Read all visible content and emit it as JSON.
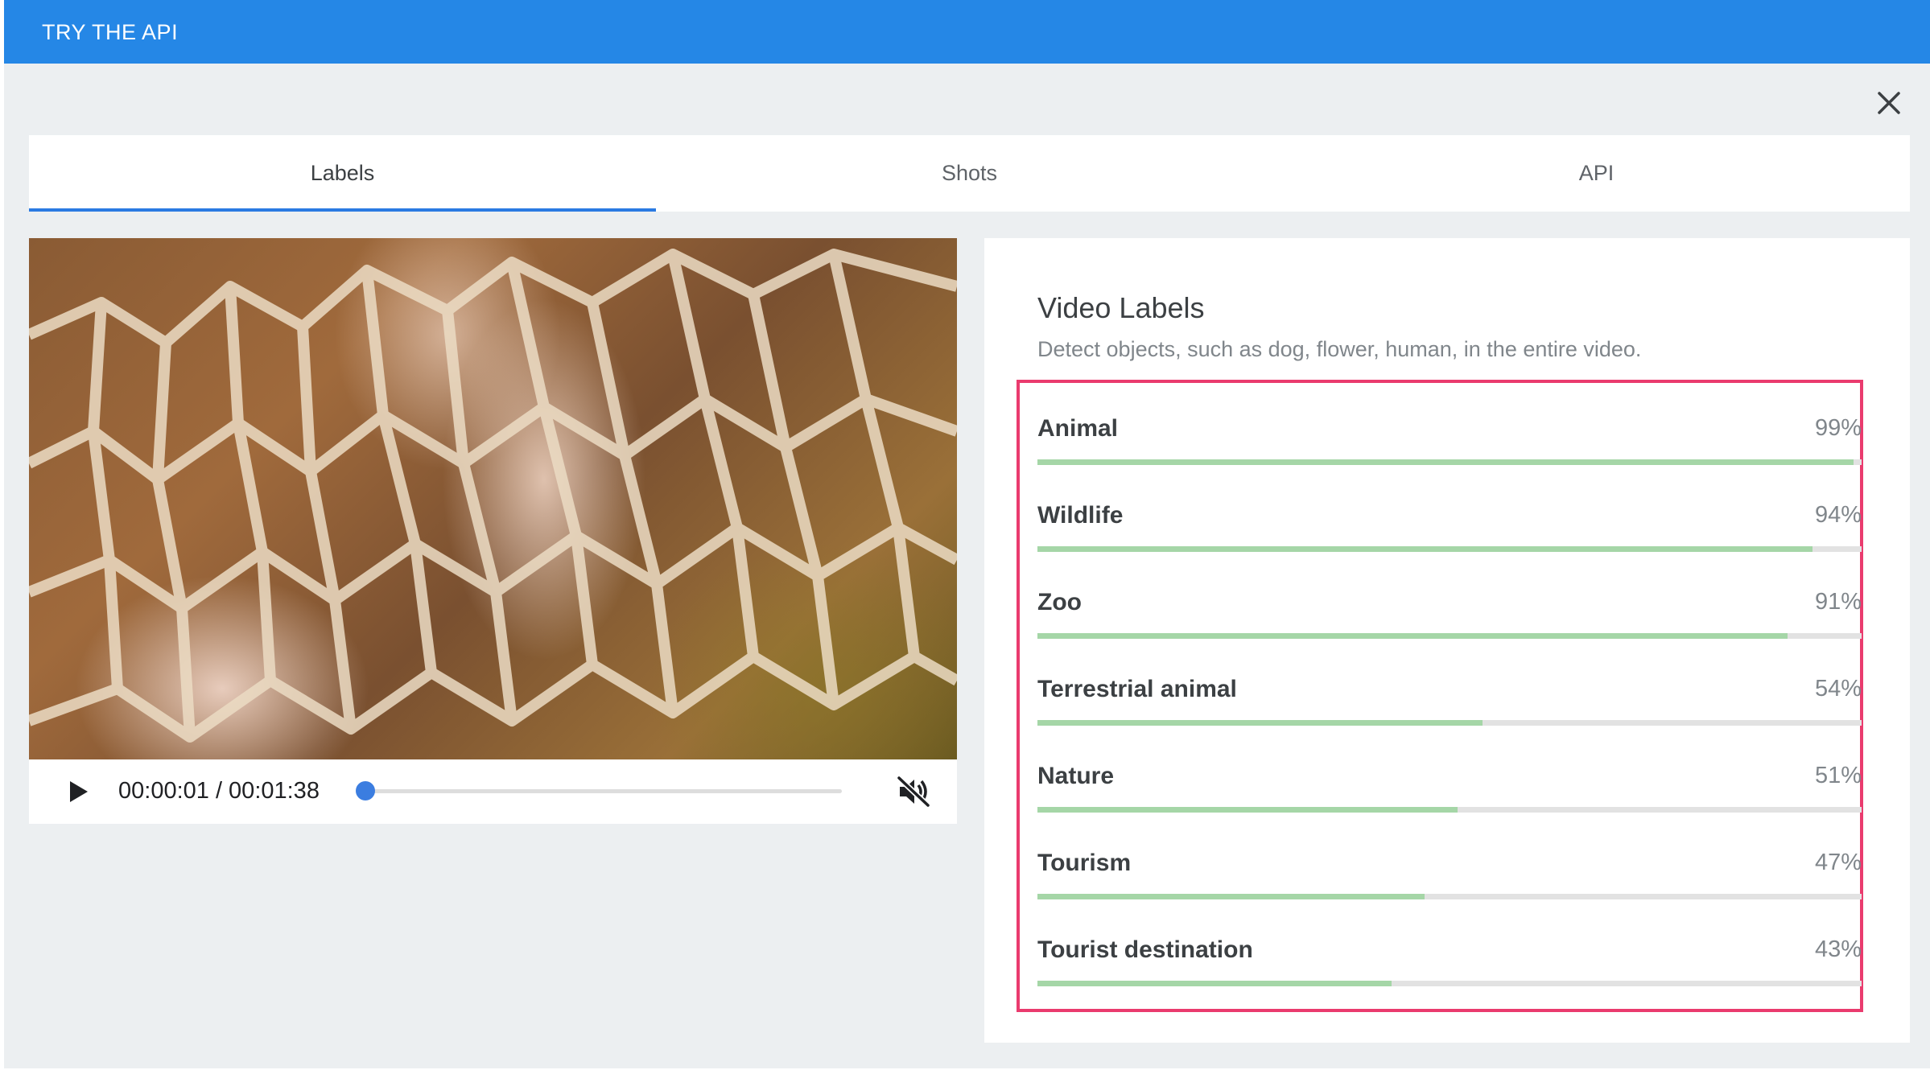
{
  "header": {
    "title": "TRY THE API"
  },
  "tabs": [
    {
      "label": "Labels",
      "active": true
    },
    {
      "label": "Shots",
      "active": false
    },
    {
      "label": "API",
      "active": false
    }
  ],
  "player": {
    "timecode": "00:00:01 / 00:01:38",
    "progress": 0.01,
    "muted": true,
    "accent_color": "#3b7de0"
  },
  "panel": {
    "title": "Video Labels",
    "subtitle": "Detect objects, such as dog, flower, human, in the entire video.",
    "highlight_color": "#ea3b6e",
    "bar_color": "#a5d6a7",
    "labels": [
      {
        "name": "Animal",
        "percent": "99%",
        "score": 0.99
      },
      {
        "name": "Wildlife",
        "percent": "94%",
        "score": 0.94
      },
      {
        "name": "Zoo",
        "percent": "91%",
        "score": 0.91
      },
      {
        "name": "Terrestrial animal",
        "percent": "54%",
        "score": 0.54
      },
      {
        "name": "Nature",
        "percent": "51%",
        "score": 0.51
      },
      {
        "name": "Tourism",
        "percent": "47%",
        "score": 0.47
      },
      {
        "name": "Tourist destination",
        "percent": "43%",
        "score": 0.43
      }
    ]
  },
  "icons": {
    "close": "close-icon",
    "play": "play-icon",
    "mute": "volume-off-icon"
  }
}
